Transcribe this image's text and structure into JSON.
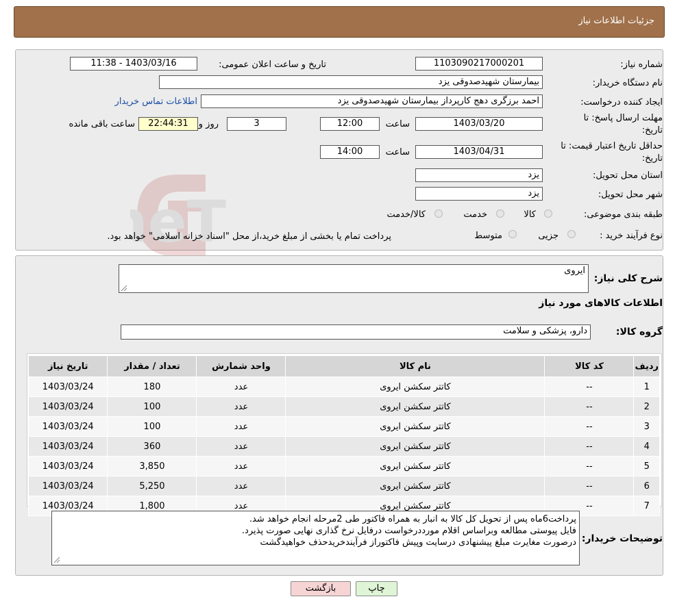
{
  "header": {
    "title": "جزئیات اطلاعات نیاز"
  },
  "form": {
    "need_number_label": "شماره نیاز:",
    "need_number": "1103090217000201",
    "announce_label": "تاریخ و ساعت اعلان عمومی:",
    "announce_value": "1403/03/16 - 11:38",
    "buyer_org_label": "نام دستگاه خریدار:",
    "buyer_org": "بیمارستان شهیدصدوقی یزد",
    "creator_label": "ایجاد کننده درخواست:",
    "creator": "احمد برزگری دهج کارپرداز بیمارستان شهیدصدوقی یزد",
    "contact_link": "اطلاعات تماس خریدار",
    "deadline_label_1": "مهلت ارسال پاسخ: تا",
    "deadline_label_2": "تاریخ:",
    "deadline_date": "1403/03/20",
    "time_label": "ساعت",
    "deadline_time": "12:00",
    "days_value": "3",
    "days_label": "روز و",
    "remaining_time": "22:44:31",
    "remaining_label": "ساعت باقی مانده",
    "validity_label_1": "حداقل تاریخ اعتبار قیمت: تا",
    "validity_label_2": "تاریخ:",
    "validity_date": "1403/04/31",
    "validity_time": "14:00",
    "province_label": "استان محل تحویل:",
    "province": "یزد",
    "city_label": "شهر محل تحویل:",
    "city": "یزد",
    "category_label": "طبقه بندی موضوعی:",
    "category_options": [
      "کالا",
      "خدمت",
      "کالا/خدمت"
    ],
    "process_label": "نوع فرآیند خرید :",
    "process_options": [
      "جزیی",
      "متوسط"
    ],
    "process_note": "پرداخت تمام یا بخشی از مبلغ خرید،از محل \"اسناد خزانه اسلامی\" خواهد بود."
  },
  "details": {
    "summary_label": "شرح کلی نیاز:",
    "summary_value": "ایروی",
    "goods_heading": "اطلاعات کالاهای مورد نیاز",
    "group_label": "گروه کالا:",
    "group_value": "دارو، پزشکی و سلامت",
    "table": {
      "headers": [
        "ردیف",
        "کد کالا",
        "نام کالا",
        "واحد شمارش",
        "تعداد / مقدار",
        "تاریخ نیاز"
      ],
      "rows": [
        [
          "1",
          "--",
          "کاتتر سکشن ایروی",
          "عدد",
          "180",
          "1403/03/24"
        ],
        [
          "2",
          "--",
          "کاتتر سکشن ایروی",
          "عدد",
          "100",
          "1403/03/24"
        ],
        [
          "3",
          "--",
          "کاتتر سکشن ایروی",
          "عدد",
          "100",
          "1403/03/24"
        ],
        [
          "4",
          "--",
          "کاتتر سکشن ایروی",
          "عدد",
          "360",
          "1403/03/24"
        ],
        [
          "5",
          "--",
          "کاتتر سکشن ایروی",
          "عدد",
          "3,850",
          "1403/03/24"
        ],
        [
          "6",
          "--",
          "کاتتر سکشن ایروی",
          "عدد",
          "5,250",
          "1403/03/24"
        ],
        [
          "7",
          "--",
          "کاتتر سکشن ایروی",
          "عدد",
          "1,800",
          "1403/03/24"
        ]
      ]
    },
    "buyer_notes_label": "توضیحات خریدار:",
    "buyer_notes": [
      "پرداخت6ماه پس از تحویل کل کالا به انبار به همراه فاکتور طی 2مرحله انجام خواهد شد.",
      "فایل پیوستی مطالعه وبراساس اقلام مورددرخواست درفایل نرخ گذاری نهایی  صورت پذیرد.",
      "درصورت مغایرت مبلغ پیشنهادی درسایت وپیش فاکتوراز فرآیندخریدحذف خواهیدگشت"
    ]
  },
  "buttons": {
    "print": "چاپ",
    "back": "بازگشت"
  },
  "watermark": {
    "text": "AriaTender.neT"
  },
  "colors": {
    "header_bg": "#a0714a",
    "panel_bg": "#ececec",
    "link": "#1a4fa6",
    "back_btn": "#f6d4d4",
    "print_btn": "#dff5d6",
    "remaining_bg": "#ffffcc"
  }
}
